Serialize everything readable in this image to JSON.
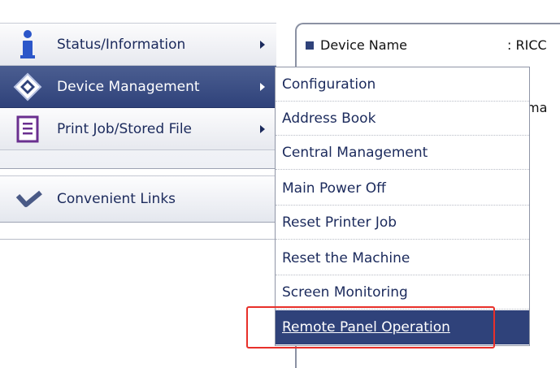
{
  "nav": {
    "items": [
      {
        "label": "Status/Information",
        "icon": "info-icon"
      },
      {
        "label": "Device Management",
        "icon": "device-management-icon"
      },
      {
        "label": "Print Job/Stored File",
        "icon": "document-icon"
      }
    ],
    "links": {
      "label": "Convenient Links",
      "icon": "checkmark-icon"
    }
  },
  "content": {
    "device_name_label": "Device Name",
    "device_name_value": ": RICC",
    "peek_text": "ma"
  },
  "submenu": {
    "items": [
      "Configuration",
      "Address Book",
      "Central Management",
      "Main Power Off",
      "Reset Printer Job",
      "Reset the Machine",
      "Screen Monitoring",
      "Remote Panel Operation"
    ],
    "selected_index": 7
  },
  "colors": {
    "accent": "#2f427a",
    "highlight_box": "#e8302a",
    "menu_text": "#1b2a5c"
  }
}
